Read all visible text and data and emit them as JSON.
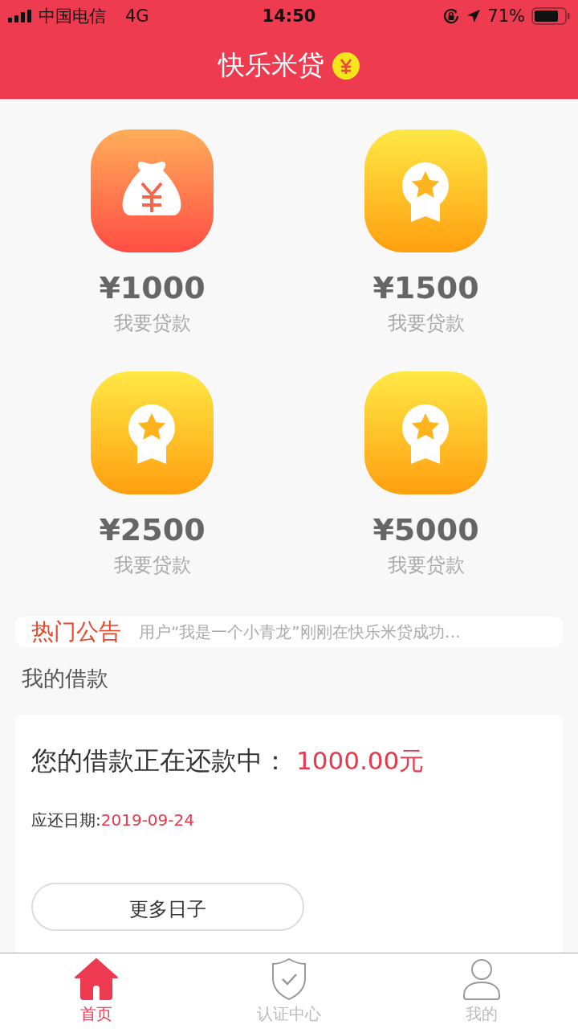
{
  "status_bar": {
    "carrier": "中国电信",
    "network": "4G",
    "time": "14:50",
    "battery": "71%"
  },
  "header": {
    "title": "快乐米贷"
  },
  "loans": [
    {
      "kind": "bag",
      "amount": "¥1000",
      "action": "我要贷款"
    },
    {
      "kind": "medal",
      "amount": "¥1500",
      "action": "我要贷款"
    },
    {
      "kind": "medal",
      "amount": "¥2500",
      "action": "我要贷款"
    },
    {
      "kind": "medal",
      "amount": "¥5000",
      "action": "我要贷款"
    }
  ],
  "notice": {
    "label": "热门公告",
    "text": "用户“我是一个小青龙”刚刚在快乐米贷成功…"
  },
  "my_loans": {
    "title": "我的借款",
    "status": "您的借款正在还款中：",
    "amount": "1000.00元",
    "due_label": "应还日期:",
    "due_date": "2019-09-24",
    "more_button": "更多日子"
  },
  "tabs": [
    {
      "kind": "home",
      "label": "首页",
      "selected": true
    },
    {
      "kind": "shield",
      "label": "认证中心",
      "selected": false
    },
    {
      "kind": "user",
      "label": "我的",
      "selected": false
    }
  ]
}
